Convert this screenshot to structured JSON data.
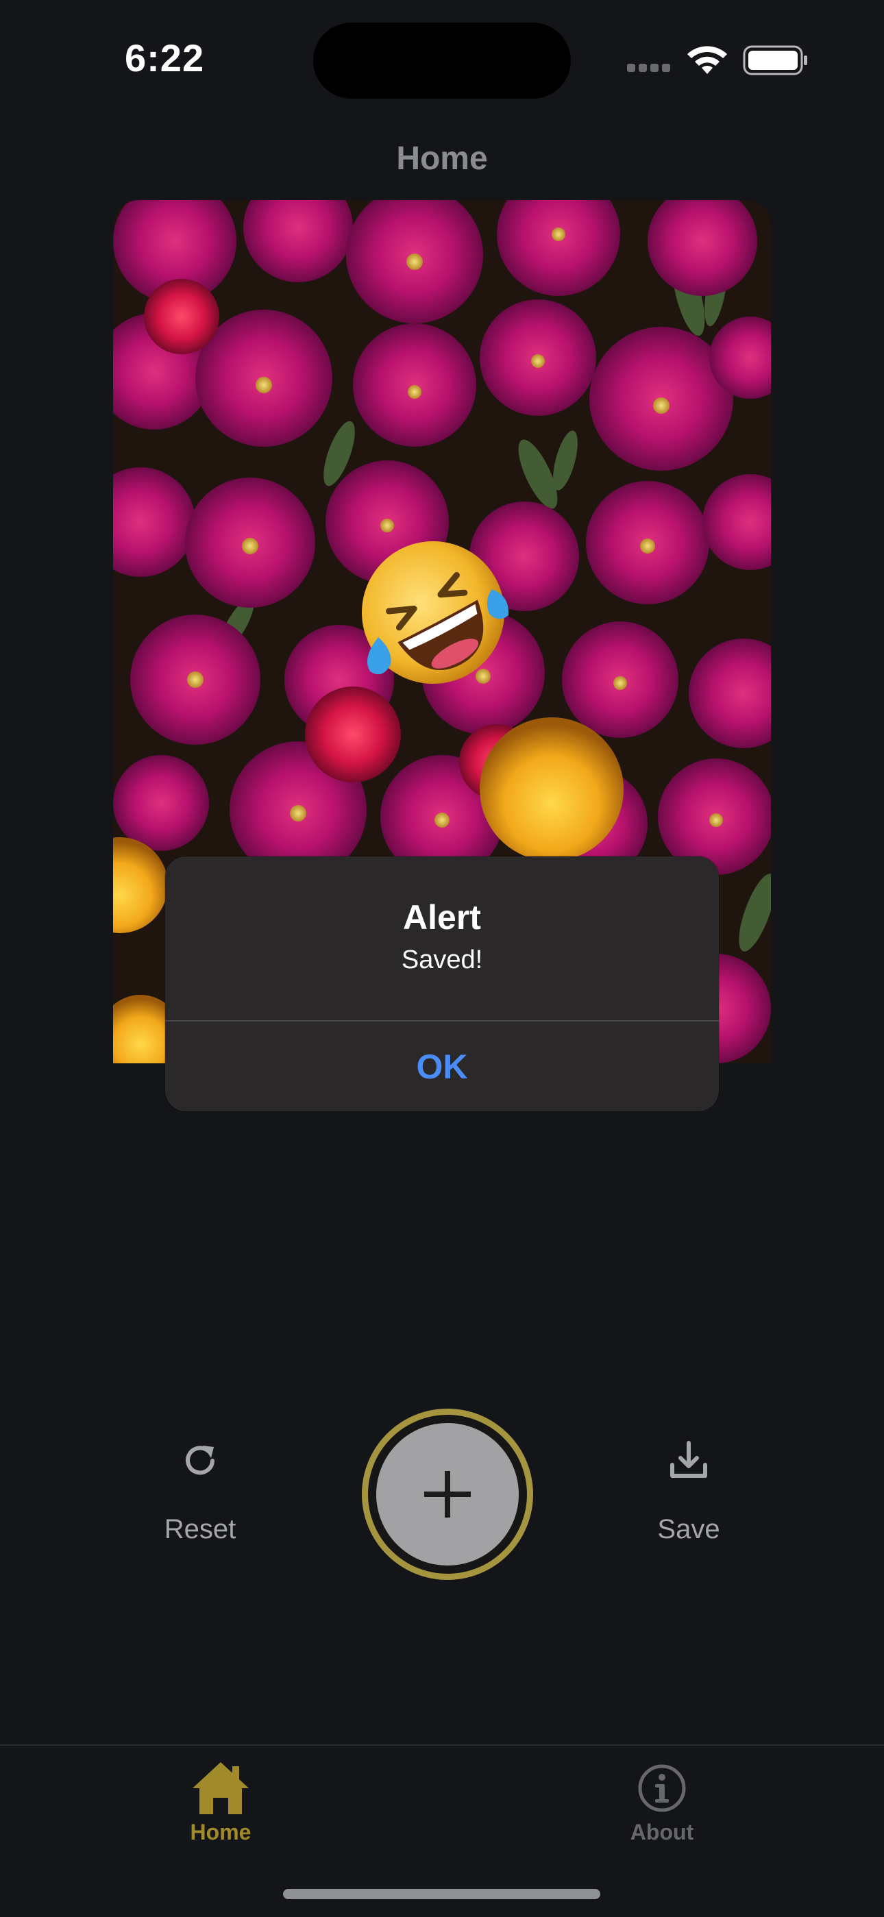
{
  "status_bar": {
    "time": "6:22"
  },
  "header": {
    "title": "Home"
  },
  "photo": {
    "description_icon": "flowers-photo",
    "sticker_icon": "rolling-on-floor-laughing-emoji"
  },
  "alert": {
    "title": "Alert",
    "message": "Saved!",
    "ok_label": "OK"
  },
  "actions": {
    "reset_label": "Reset",
    "save_label": "Save",
    "add_icon": "plus-icon"
  },
  "tab_bar": {
    "items": [
      {
        "label": "Home",
        "icon": "house-icon",
        "active": true
      },
      {
        "label": "About",
        "icon": "info-circle-icon",
        "active": false
      }
    ]
  },
  "colors": {
    "accent": "#a08a2a",
    "alert_button": "#4a8df7",
    "background": "#141518"
  }
}
